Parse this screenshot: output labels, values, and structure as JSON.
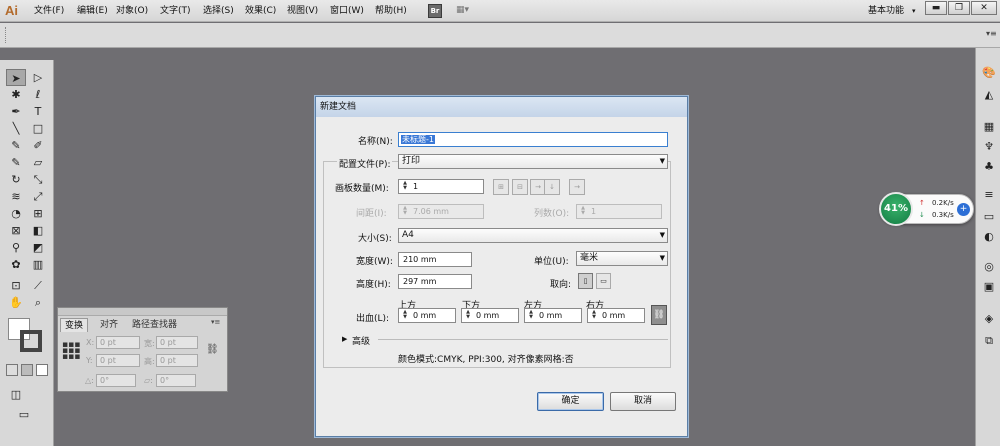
{
  "app": {
    "logo": "Ai"
  },
  "menubar": {
    "items": [
      "文件(F)",
      "编辑(E)",
      "对象(O)",
      "文字(T)",
      "选择(S)",
      "效果(C)",
      "视图(V)",
      "窗口(W)",
      "帮助(H)"
    ],
    "bridge_label": "Br",
    "workspace_label": "基本功能",
    "workspace_arrow": "▾",
    "window_buttons": [
      "▬",
      "❐",
      "✕"
    ]
  },
  "toolbar": {
    "icons": [
      "selection-tool-icon",
      "direct-selection-tool-icon",
      "magic-wand-icon",
      "lasso-icon",
      "pen-tool-icon",
      "type-tool-icon",
      "line-tool-icon",
      "rectangle-tool-icon",
      "paintbrush-icon",
      "pencil-icon",
      "blob-brush-icon",
      "eraser-icon",
      "rotate-icon",
      "scale-icon",
      "width-tool-icon",
      "free-transform-icon",
      "shape-builder-icon",
      "perspective-grid-icon",
      "mesh-icon",
      "gradient-icon",
      "eyedropper-icon",
      "blend-icon",
      "symbol-sprayer-icon",
      "column-graph-icon",
      "artboard-icon",
      "slice-icon",
      "hand-icon",
      "zoom-icon"
    ],
    "glyphs": [
      "➤",
      "▷",
      "✱",
      "ℓ",
      "✒",
      "T",
      "╲",
      "□",
      "✎",
      "✐",
      "✎",
      "▱",
      "↻",
      "⤡",
      "≋",
      "⤢",
      "◔",
      "⊞",
      "⊠",
      "◧",
      "⚲",
      "◩",
      "✿",
      "▥",
      "⊡",
      "⟋",
      "✋",
      "⌕"
    ]
  },
  "rightpanel": {
    "icons": [
      "color-guide-icon",
      "color-icon",
      "swatches-icon",
      "brushes-icon",
      "symbols-icon",
      "stroke-icon",
      "gradient-panel-icon",
      "transparency-icon",
      "appearance-icon",
      "graphic-styles-icon",
      "layers-icon",
      "artboards-icon"
    ],
    "glyphs": [
      "🎨",
      "◭",
      "▦",
      "♆",
      "♣",
      "≡",
      "▭",
      "◐",
      "◎",
      "▣",
      "◈",
      "⧉"
    ]
  },
  "transform_panel": {
    "tabs": [
      "变换",
      "对齐",
      "路径查找器"
    ],
    "menu_glyph": "▾≡",
    "x_label": "X:",
    "y_label": "Y:",
    "w_label": "宽:",
    "h_label": "高:",
    "x_value": "0 pt",
    "y_value": "0 pt",
    "w_value": "0 pt",
    "h_value": "0 pt",
    "rotate_value": "0°",
    "shear_value": "0°"
  },
  "dialog": {
    "title": "新建文档",
    "name_label": "名称(N):",
    "name_value": "未标题-1",
    "profile_label": "配置文件(P):",
    "profile_value": "打印",
    "artboards_label": "画板数量(M):",
    "artboards_value": "1",
    "spacing_label": "间距(I):",
    "spacing_value": "7.06 mm",
    "columns_label": "列数(O):",
    "columns_value": "1",
    "size_label": "大小(S):",
    "size_value": "A4",
    "width_label": "宽度(W):",
    "width_value": "210 mm",
    "units_label": "单位(U):",
    "units_value": "毫米",
    "height_label": "高度(H):",
    "height_value": "297 mm",
    "orientation_label": "取向:",
    "bleed_label": "出血(L):",
    "bleed_top_label": "上方",
    "bleed_bottom_label": "下方",
    "bleed_left_label": "左方",
    "bleed_right_label": "右方",
    "bleed_top": "0 mm",
    "bleed_bottom": "0 mm",
    "bleed_left": "0 mm",
    "bleed_right": "0 mm",
    "advanced_label": "高级",
    "summary": "颜色模式:CMYK, PPI:300, 对齐像素网格:否",
    "ok_label": "确定",
    "cancel_label": "取消"
  },
  "net_widget": {
    "percent": "41%",
    "upload": "0.2K/s",
    "download": "0.3K/s",
    "accent": "#1f8f50"
  }
}
